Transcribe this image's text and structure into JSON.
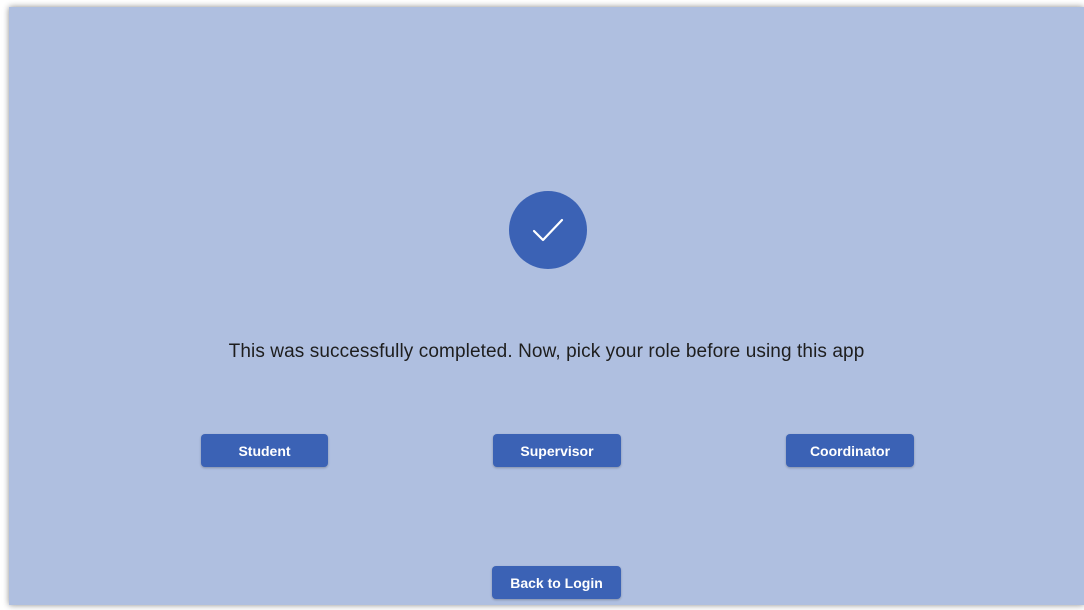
{
  "screen": {
    "background_color": "#afbfe0",
    "accent_color": "#3b62b5",
    "status_icon": "checkmark-icon",
    "message": "This was successfully completed. Now, pick your role before using this app"
  },
  "roles": {
    "student_label": "Student",
    "supervisor_label": "Supervisor",
    "coordinator_label": "Coordinator"
  },
  "navigation": {
    "back_label": "Back to Login"
  }
}
